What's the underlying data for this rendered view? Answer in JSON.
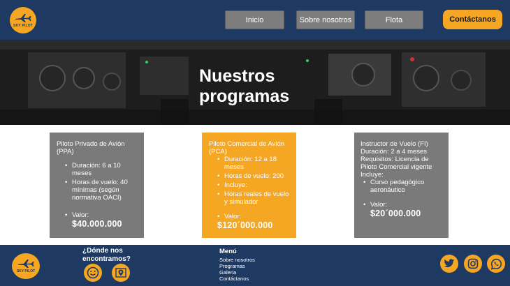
{
  "brand": {
    "logo_text": "SKY PILOT"
  },
  "nav": {
    "inicio": "Inicio",
    "sobre": "Sobre nosotros",
    "flota": "Flota",
    "contact": "Contáctanos"
  },
  "hero": {
    "title_line1": "Nuestros",
    "title_line2": "programas"
  },
  "programs": [
    {
      "title": "Piloto Privado de Avión (PPA)",
      "bullets": [
        "Duración: 6 a 10 meses",
        "Horas de vuelo: 40 mínimas (según normativa OACI)"
      ],
      "value_label": "Valor:",
      "price": "$40.000.000"
    },
    {
      "title": "Piloto Comercial de Avión (PCA)",
      "bullets": [
        "Duración: 12 a 18 meses",
        "Horas de vuelo: 200",
        "Incluye:",
        "Horas reales de vuelo y simulador"
      ],
      "value_label": "Valor:",
      "price": "$120´000.000"
    },
    {
      "title": "Instructor de Vuelo (FI)",
      "line_duration": "Duración: 2 a 4 meses",
      "line_requirements": "Requisitos: Licencia de Piloto Comercial vigente",
      "line_includes": "Incluye:",
      "bullets": [
        "Curso pedagógico aeronáutico"
      ],
      "value_label": "Valor:",
      "price": "$20´000.000"
    }
  ],
  "footer": {
    "where_line1": "¿Dónde nos",
    "where_line2": "encontramos?",
    "menu_title": "Menú",
    "menu_items": [
      "Sobre nosotros",
      "Programas",
      "Galeria",
      "Contáctanos"
    ]
  },
  "colors": {
    "navy": "#1e3a63",
    "accent": "#f5a623",
    "card_gray": "#7a7a7a"
  },
  "icons": [
    "airplane-icon",
    "smile-icon",
    "map-pin-icon",
    "twitter-icon",
    "instagram-icon",
    "whatsapp-icon"
  ]
}
